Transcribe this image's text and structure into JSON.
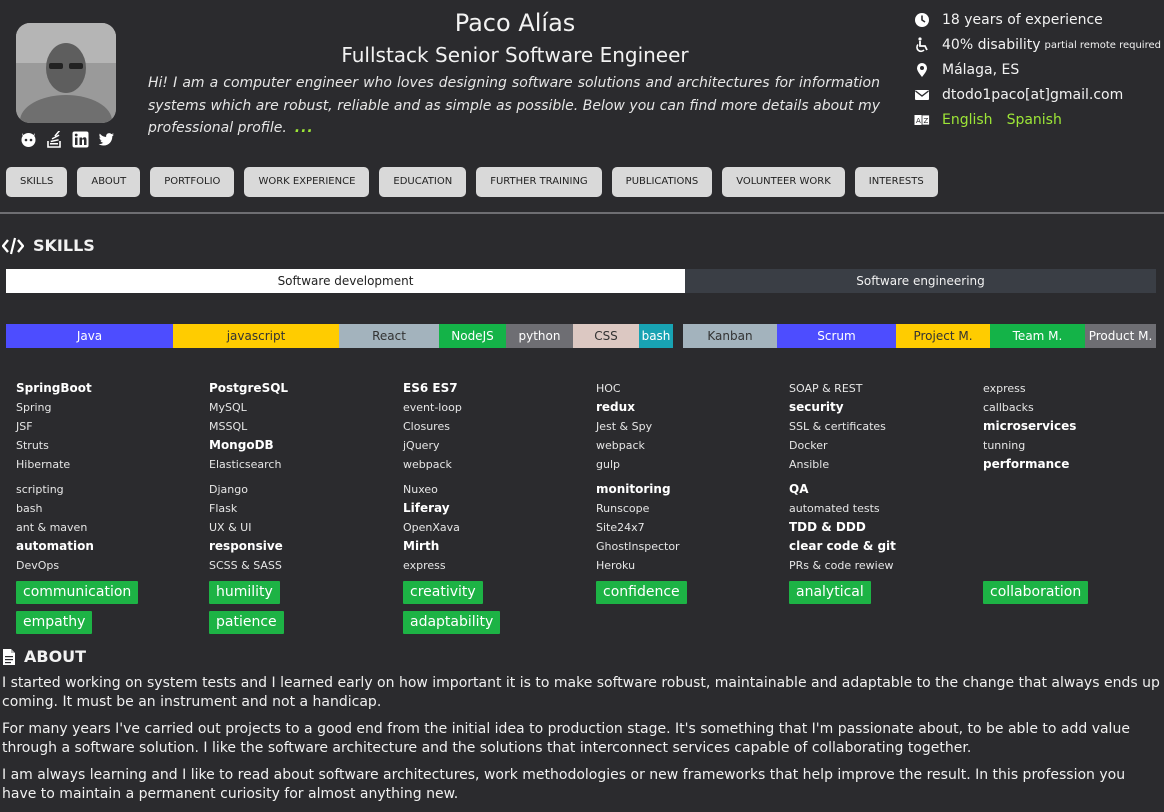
{
  "header": {
    "name": "Paco Alías",
    "role": "Fullstack Senior Software Engineer",
    "intro": "Hi! I am a computer engineer who loves designing software solutions and architectures for information systems which are robust, reliable and as simple as possible. Below you can find more details about my professional profile.",
    "more": "..."
  },
  "info": {
    "experience": "18 years of experience",
    "disability": "40% disability",
    "disability_note": "partial remote required",
    "location": "Málaga, ES",
    "email": "dtodo1paco[at]gmail.com",
    "lang_en": "English",
    "lang_es": "Spanish"
  },
  "social_icons": [
    "github-icon",
    "stackoverflow-icon",
    "linkedin-icon",
    "twitter-icon"
  ],
  "nav": [
    "SKILLS",
    "ABOUT",
    "PORTFOLIO",
    "WORK EXPERIENCE",
    "EDUCATION",
    "FURTHER TRAINING",
    "PUBLICATIONS",
    "VOLUNTEER WORK",
    "INTERESTS"
  ],
  "skills": {
    "title": "SKILLS",
    "tabs": [
      "Software development",
      "Software engineering"
    ],
    "bars_dev": [
      {
        "label": "Java",
        "color": "#4d4dff"
      },
      {
        "label": "javascript",
        "color": "#ffcc00"
      },
      {
        "label": "React",
        "color": "#a3b3bd"
      },
      {
        "label": "NodeJS",
        "color": "#14b348"
      },
      {
        "label": "python",
        "color": "#6e6e73"
      },
      {
        "label": "CSS",
        "color": "#dcc8c2"
      },
      {
        "label": "bash",
        "color": "#18a3b3"
      }
    ],
    "bars_eng": [
      {
        "label": "Kanban",
        "color": "#a3b3bd"
      },
      {
        "label": "Scrum",
        "color": "#4d4dff"
      },
      {
        "label": "Project M.",
        "color": "#ffcc00"
      },
      {
        "label": "Team M.",
        "color": "#14b348"
      },
      {
        "label": "Product M.",
        "color": "#6e6e73"
      }
    ],
    "columns": [
      {
        "group1": [
          "SpringBoot",
          "Spring",
          "JSF",
          "Struts",
          "Hibernate"
        ],
        "group2": [
          "scripting",
          "bash",
          "ant & maven",
          "automation",
          "DevOps"
        ]
      },
      {
        "group1": [
          "PostgreSQL",
          "MySQL",
          "MSSQL",
          "MongoDB",
          "Elasticsearch"
        ],
        "group2": [
          "Django",
          "Flask",
          "UX & UI",
          "responsive",
          "SCSS & SASS"
        ]
      },
      {
        "group1": [
          "ES6 ES7",
          "event-loop",
          "Closures",
          "jQuery",
          "webpack"
        ],
        "group2": [
          "Nuxeo",
          "Liferay",
          "OpenXava",
          "Mirth",
          "express"
        ]
      },
      {
        "group1": [
          "HOC",
          "redux",
          "Jest & Spy",
          "webpack",
          "gulp"
        ],
        "group2": [
          "monitoring",
          "Runscope",
          "Site24x7",
          "GhostInspector",
          "Heroku"
        ]
      },
      {
        "group1": [
          "SOAP & REST",
          "security",
          "SSL & certificates",
          "Docker",
          "Ansible"
        ],
        "group2": [
          "QA",
          "automated tests",
          "TDD & DDD",
          "clear code & git",
          "PRs & code rewiew"
        ]
      },
      {
        "group1": [
          "express",
          "callbacks",
          "microservices",
          "tunning",
          "performance"
        ],
        "group2": []
      }
    ],
    "soft_row1": [
      "communication",
      "humility",
      "creativity",
      "confidence",
      "analytical",
      "collaboration"
    ],
    "soft_row2": [
      "empathy",
      "patience",
      "adaptability"
    ]
  },
  "about": {
    "title": "ABOUT",
    "p1": "I started working on system tests and I learned early on how important it is to make software robust, maintainable and adaptable to the change that always ends up coming. It must be an instrument and not a handicap.",
    "p2": "For many years I've carried out projects to a good end from the initial idea to production stage. It's something that I'm passionate about, to be able to add value through a software solution. I like the software architecture and the solutions that interconnect services capable of collaborating together.",
    "p3": "I am always learning and I like to read about software architectures, work methodologies or new frameworks that help improve the result. In this profession you have to maintain a permanent curiosity for almost anything new."
  }
}
